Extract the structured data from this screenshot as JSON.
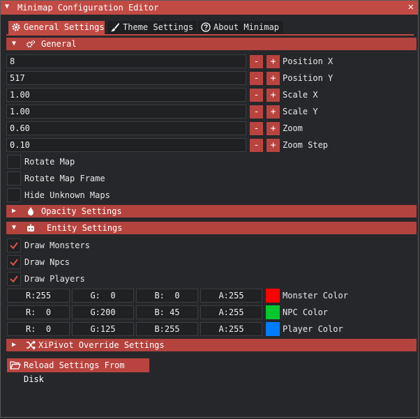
{
  "window": {
    "title": "Minimap Configuration Editor",
    "close_glyph": "✕"
  },
  "tabs": [
    {
      "label": "General Settings",
      "icon": "gear-icon",
      "active": true
    },
    {
      "label": "Theme Settings",
      "icon": "brush-icon",
      "active": false
    },
    {
      "label": "About Minimap",
      "icon": "question-circle-icon",
      "active": false
    }
  ],
  "general": {
    "header": "General",
    "rows": [
      {
        "value": "8",
        "label": "Position X"
      },
      {
        "value": "517",
        "label": "Position Y"
      },
      {
        "value": "1.00",
        "label": "Scale X"
      },
      {
        "value": "1.00",
        "label": "Scale Y"
      },
      {
        "value": "0.60",
        "label": "Zoom"
      },
      {
        "value": "0.10",
        "label": "Zoom Step"
      }
    ],
    "minus": "-",
    "plus": "+",
    "checkboxes": [
      {
        "label": "Rotate Map",
        "checked": false
      },
      {
        "label": "Rotate Map Frame",
        "checked": false
      },
      {
        "label": "Hide Unknown Maps",
        "checked": false
      }
    ]
  },
  "opacity": {
    "header": "Opacity Settings"
  },
  "entity": {
    "header": "Entity Settings",
    "checkboxes": [
      {
        "label": "Draw Monsters",
        "checked": true
      },
      {
        "label": "Draw Npcs",
        "checked": true
      },
      {
        "label": "Draw Players",
        "checked": true
      }
    ],
    "colors": [
      {
        "r": "R:255",
        "g": "G:  0",
        "b": "B:  0",
        "a": "A:255",
        "hex": "#ff0000",
        "label": "Monster Color"
      },
      {
        "r": "R:  0",
        "g": "G:200",
        "b": "B: 45",
        "a": "A:255",
        "hex": "#00c82d",
        "label": "NPC Color"
      },
      {
        "r": "R:  0",
        "g": "G:125",
        "b": "B:255",
        "a": "A:255",
        "hex": "#007dff",
        "label": "Player Color"
      }
    ]
  },
  "xipivot": {
    "header": "XiPivot Override Settings"
  },
  "reload_button": "Reload Settings From Disk",
  "colors": {
    "accent": "#c24a44",
    "background": "#26272a",
    "input_bg": "#202123"
  }
}
